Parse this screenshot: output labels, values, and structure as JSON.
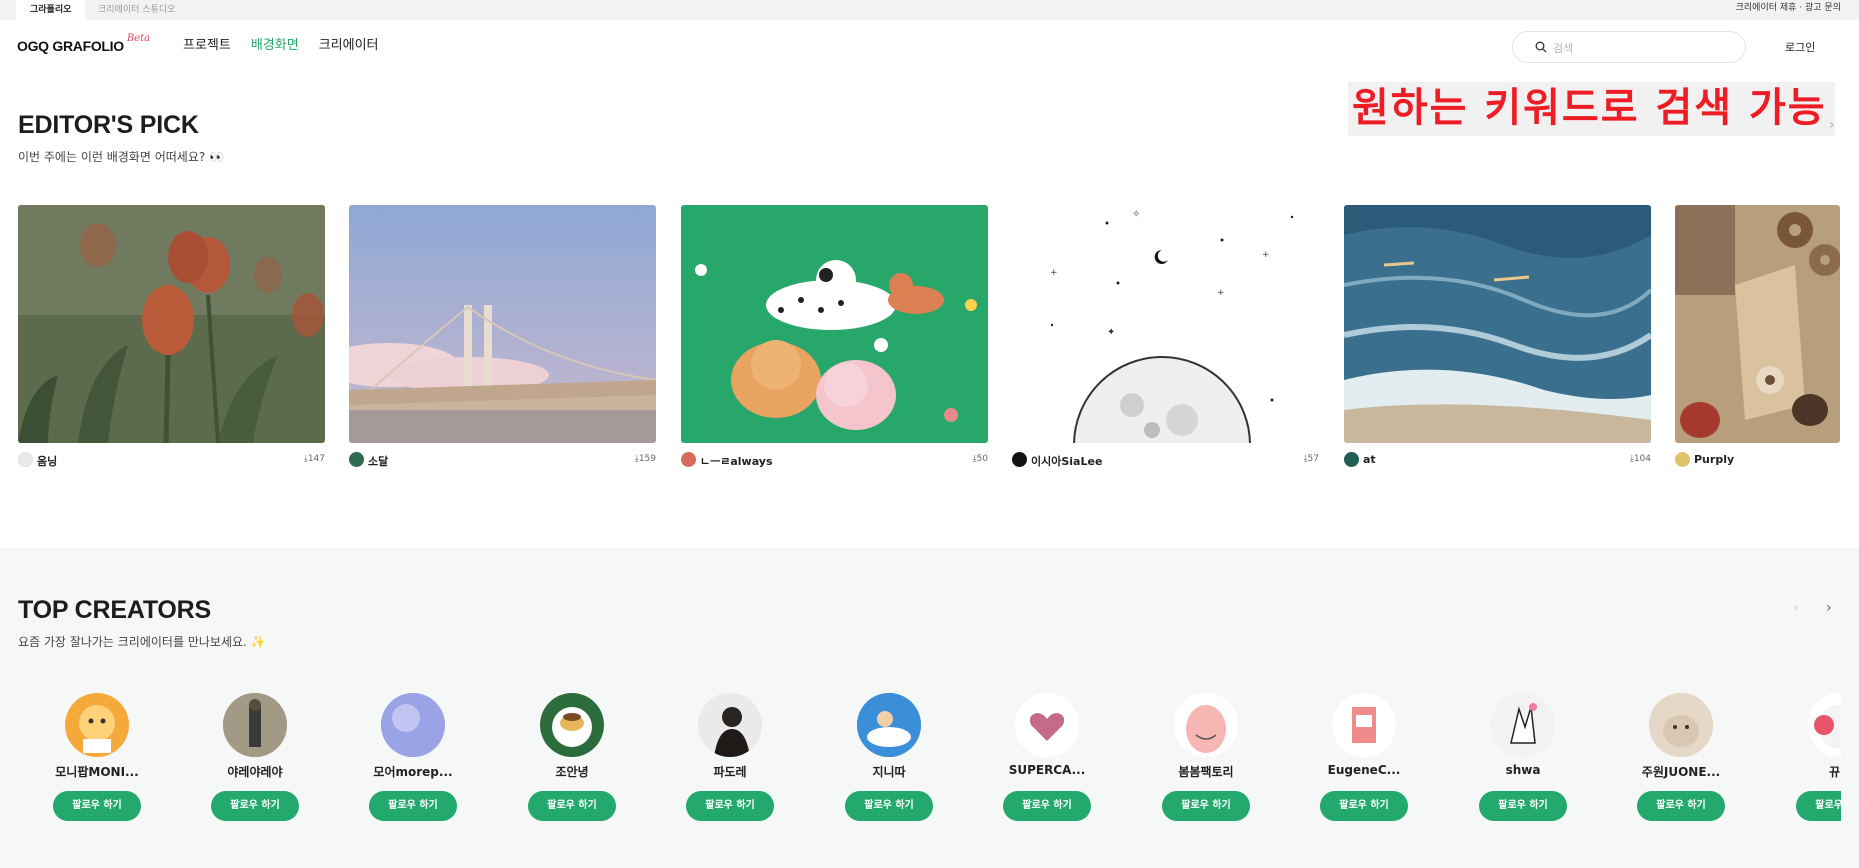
{
  "top_tabs": [
    {
      "label": "그라폴리오"
    },
    {
      "label": "크리에이터 스튜디오"
    }
  ],
  "top_links": "크리에이터 제휴 · 광고 문의",
  "logo": {
    "text": "OGQ GRAFOLIO",
    "badge": "Beta"
  },
  "nav": [
    {
      "label": "프로젝트"
    },
    {
      "label": "배경화면"
    },
    {
      "label": "크리에이터"
    }
  ],
  "search": {
    "placeholder": "검색",
    "value": ""
  },
  "login_label": "로그인",
  "overlay_text": "원하는 키워드로 검색 가능",
  "editors_pick": {
    "title": "EDITOR'S PICK",
    "subtitle": "이번 주에는 이런 배경화면 어떠세요? 👀",
    "items": [
      {
        "author": "옴닝",
        "downloads": "147"
      },
      {
        "author": "소달",
        "downloads": "159"
      },
      {
        "author": "ㄴㅡㄹalways",
        "downloads": "50"
      },
      {
        "author": "이시아SiaLee",
        "downloads": "57"
      },
      {
        "author": "at",
        "downloads": "104"
      },
      {
        "author": "Purply",
        "downloads": ""
      }
    ]
  },
  "top_creators": {
    "title": "TOP CREATORS",
    "subtitle": "요즘 가장 잘나가는 크리에이터를 만나보세요. ✨",
    "follow_label": "팔로우 하기",
    "items": [
      {
        "name": "모니팝MONI..."
      },
      {
        "name": "야레야레야"
      },
      {
        "name": "모어morep..."
      },
      {
        "name": "조안녕"
      },
      {
        "name": "파도레"
      },
      {
        "name": "지니따"
      },
      {
        "name": "SUPERCA..."
      },
      {
        "name": "봄봄팩토리"
      },
      {
        "name": "EugeneC..."
      },
      {
        "name": "shwa"
      },
      {
        "name": "주원JUONE..."
      },
      {
        "name": "뀨니"
      }
    ]
  },
  "colors": {
    "accent": "#23a86d",
    "overlay_text": "#ee1c24"
  }
}
